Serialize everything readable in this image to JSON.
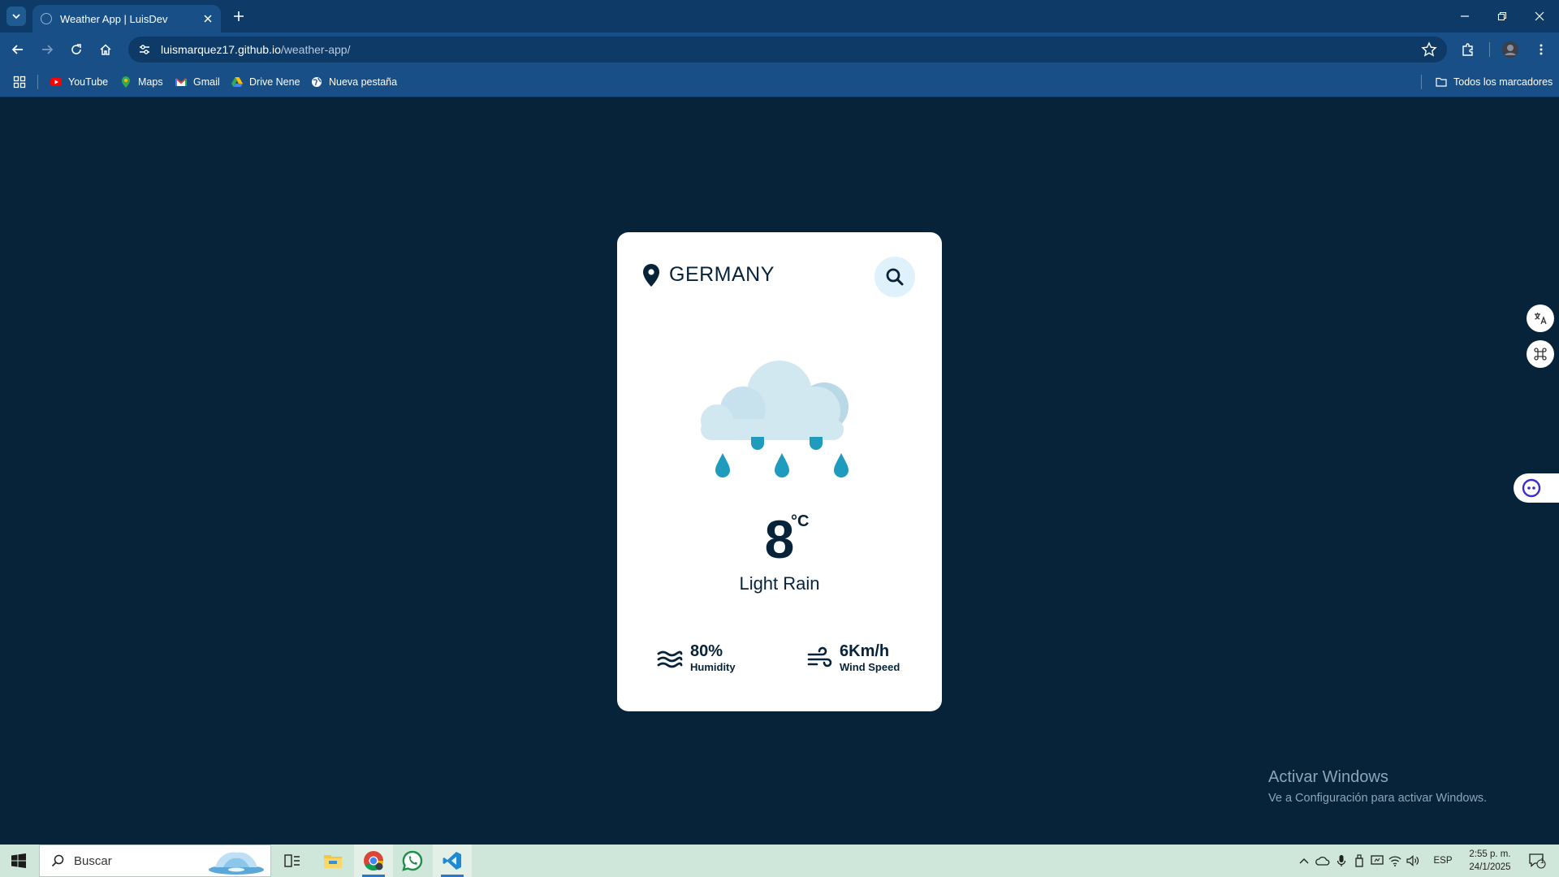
{
  "browser": {
    "tab_title": "Weather App | LuisDev",
    "url_host": "luismarquez17.github.io",
    "url_path": "/weather-app/",
    "bookmarks": [
      "YouTube",
      "Maps",
      "Gmail",
      "Drive Nene",
      "Nueva pestaña"
    ],
    "all_bookmarks": "Todos los marcadores"
  },
  "weather": {
    "country": "GERMANY",
    "temperature": "8",
    "unit": "°C",
    "description": "Light Rain",
    "humidity_value": "80%",
    "humidity_label": "Humidity",
    "wind_value": "6Km/h",
    "wind_label": "Wind Speed",
    "icon": "rain-cloud-icon"
  },
  "watermark": {
    "line1": "Activar Windows",
    "line2": "Ve a Configuración para activar Windows."
  },
  "taskbar": {
    "search_placeholder": "Buscar",
    "language": "ESP",
    "time": "2:55 p. m.",
    "date": "24/1/2025",
    "notification_count": "1"
  },
  "colors": {
    "page_bg": "#06233a",
    "card_bg": "#ffffff",
    "accent_drop": "#1f9bbd",
    "search_bg": "#dff1fa"
  }
}
